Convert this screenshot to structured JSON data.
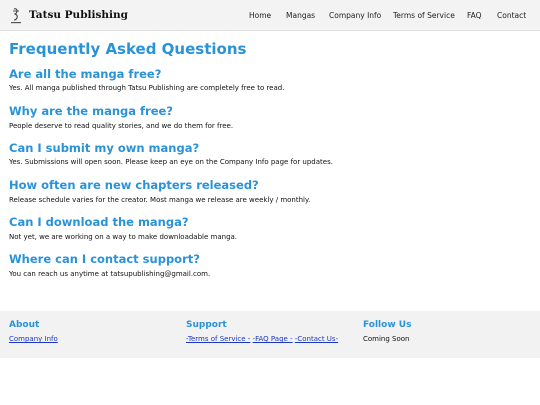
{
  "header": {
    "brand": "Tatsu Publishing",
    "nav": [
      "Home",
      "Mangas",
      "Company Info",
      "Terms of Service",
      "FAQ",
      "Contact"
    ]
  },
  "main": {
    "title": "Frequently Asked Questions",
    "faqs": [
      {
        "q": "Are all the manga free?",
        "a": "Yes. All manga published through Tatsu Publishing are completely free to read."
      },
      {
        "q": "Why are the manga free?",
        "a": "People deserve to read quality stories, and we do them for free."
      },
      {
        "q": "Can I submit my own manga?",
        "a": "Yes. Submissions will open soon. Please keep an eye on the Company Info page for updates."
      },
      {
        "q": "How often are new chapters released?",
        "a": "Release schedule varies for the creator. Most manga we release are weekly / monthly."
      },
      {
        "q": "Can I download the manga?",
        "a": "Not yet, we are working on a way to make downloadable manga."
      },
      {
        "q": "Where can I contact support?",
        "a": "You can reach us anytime at tatsupublishing@gmail.com."
      }
    ]
  },
  "footer": {
    "about": {
      "heading": "About",
      "link": "Company Info"
    },
    "support": {
      "heading": "Support",
      "links": [
        "-Terms of Service -",
        "-FAQ Page -",
        "-Contact Us-"
      ]
    },
    "follow": {
      "heading": "Follow Us",
      "text": "Coming Soon"
    }
  },
  "colors": {
    "accent": "#2a93d8",
    "link": "#1a38c4",
    "header_bg": "#f3f3f3",
    "footer_bg": "#f2f2f2"
  },
  "icons": {
    "logo": "tatsu-logo-icon"
  }
}
